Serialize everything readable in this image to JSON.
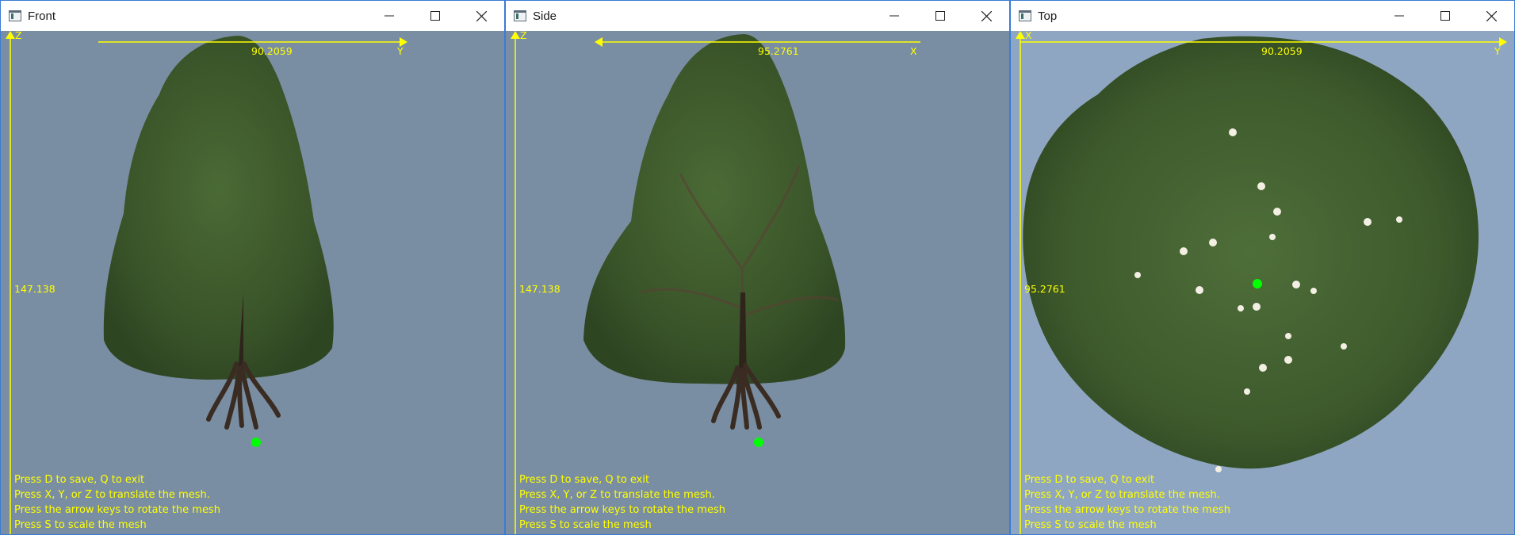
{
  "help_lines": [
    "Press D to save, Q to exit",
    "Press X, Y, or Z to translate the mesh.",
    "Press the arrow keys to rotate the mesh",
    "Press S to scale the mesh"
  ],
  "windows": [
    {
      "title": "Front",
      "vertical_axis_label": "Z",
      "horizontal_axis_label": "Y",
      "horizontal_measure": "90.2059",
      "vertical_measure": "147.138",
      "horizontal_arrow_direction": "right"
    },
    {
      "title": "Side",
      "vertical_axis_label": "Z",
      "horizontal_axis_label": "X",
      "horizontal_measure": "95.2761",
      "vertical_measure": "147.138",
      "horizontal_arrow_direction": "left"
    },
    {
      "title": "Top",
      "vertical_axis_label": "X",
      "horizontal_axis_label": "Y",
      "horizontal_measure": "90.2059",
      "vertical_measure": "95.2761",
      "horizontal_arrow_direction": "right"
    }
  ],
  "colors": {
    "viewport_side": "#7a8ea3",
    "viewport_top": "#8fa6c2",
    "axis": "#ffff00",
    "pivot": "#00ff00",
    "foliage": "#3f5a2e",
    "trunk": "#3a2a20"
  },
  "icons": {
    "app": "app-window-icon",
    "minimize": "minimize-icon",
    "maximize": "maximize-icon",
    "close": "close-icon"
  }
}
